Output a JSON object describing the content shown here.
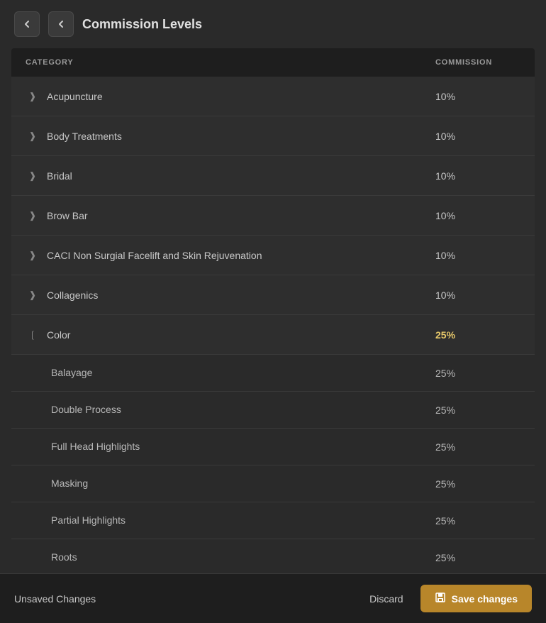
{
  "header": {
    "title": "Commission Levels",
    "back_label": "←",
    "nav_label": "‹"
  },
  "table": {
    "columns": {
      "category": "CATEGORY",
      "commission": "COMMISSION"
    },
    "rows": [
      {
        "id": "acupuncture",
        "name": "Acupuncture",
        "commission": "10%",
        "expanded": false,
        "children": []
      },
      {
        "id": "body-treatments",
        "name": "Body Treatments",
        "commission": "10%",
        "expanded": false,
        "children": []
      },
      {
        "id": "bridal",
        "name": "Bridal",
        "commission": "10%",
        "expanded": false,
        "children": []
      },
      {
        "id": "brow-bar",
        "name": "Brow Bar",
        "commission": "10%",
        "expanded": false,
        "children": []
      },
      {
        "id": "caci",
        "name": "CACI Non Surgial Facelift and Skin Rejuvenation",
        "commission": "10%",
        "expanded": false,
        "children": []
      },
      {
        "id": "collagenics",
        "name": "Collagenics",
        "commission": "10%",
        "expanded": false,
        "children": []
      },
      {
        "id": "color",
        "name": "Color",
        "commission": "25%",
        "expanded": true,
        "highlight": true,
        "children": [
          {
            "id": "balayage",
            "name": "Balayage",
            "commission": "25%"
          },
          {
            "id": "double-process",
            "name": "Double Process",
            "commission": "25%"
          },
          {
            "id": "full-head-highlights",
            "name": "Full Head Highlights",
            "commission": "25%"
          },
          {
            "id": "masking",
            "name": "Masking",
            "commission": "25%"
          },
          {
            "id": "partial-highlights",
            "name": "Partial Highlights",
            "commission": "25%"
          },
          {
            "id": "roots",
            "name": "Roots",
            "commission": "25%"
          }
        ]
      }
    ]
  },
  "footer": {
    "unsaved_label": "Unsaved Changes",
    "discard_label": "Discard",
    "save_label": "Save changes"
  }
}
